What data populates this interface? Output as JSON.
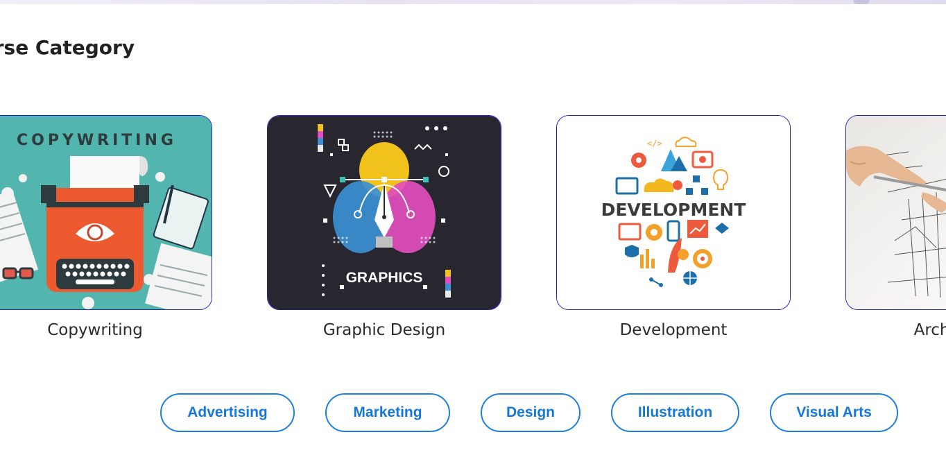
{
  "page": {
    "section_title": "Course Category"
  },
  "categories": [
    {
      "label": "Copywriting",
      "image_text": "COPYWRITING"
    },
    {
      "label": "Graphic Design",
      "image_text": "GRAPHICS"
    },
    {
      "label": "Development",
      "image_text": "DEVELOPMENT"
    },
    {
      "label": "Architecture"
    }
  ],
  "tags": [
    "Advertising",
    "Marketing",
    "Design",
    "Illustration",
    "Visual Arts"
  ],
  "colors": {
    "card_border": "#2222cc",
    "tag_border": "#1c7fe0",
    "tag_text": "#1577d8",
    "copy_bg": "#53b6ae",
    "graphic_bg": "#28262f"
  }
}
